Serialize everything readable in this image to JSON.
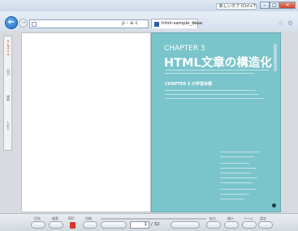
{
  "window": {
    "new_tab_label": "新しいタブ (Ctrl+T)",
    "minimize": "–",
    "maximize": "□",
    "close": "✕"
  },
  "nav": {
    "back_symbol": "←",
    "forward_symbol": "→",
    "address_search_text": "ρ - ≡ c",
    "tab_title": "html-sample_base",
    "tab_close": "×",
    "toolbar_icons": [
      "☆",
      "⚙"
    ]
  },
  "left_panel": {
    "tabs": [
      {
        "label": "サムネイル",
        "active": true
      },
      {
        "label": "目次",
        "active": false
      },
      {
        "label": "検索",
        "active": false
      },
      {
        "label": "しおり",
        "active": false
      }
    ]
  },
  "page": {
    "chapter_label": "CHAPTER 3",
    "chapter_title": "HTML文章の構造化",
    "goals_heading": "CHAPTER 3 の学習目標"
  },
  "bottom_toolbar": {
    "labels": [
      "目次",
      "検索",
      "PDF",
      "印刷",
      "拡大",
      "縮小",
      "ページ",
      "設定"
    ],
    "current_page": "1",
    "page_total": "/ 32"
  },
  "colors": {
    "teal_page": "#7ac4cb",
    "back_button": "#1e6ec3",
    "close_button": "#c8432c",
    "pdf_icon": "#d8342b"
  }
}
